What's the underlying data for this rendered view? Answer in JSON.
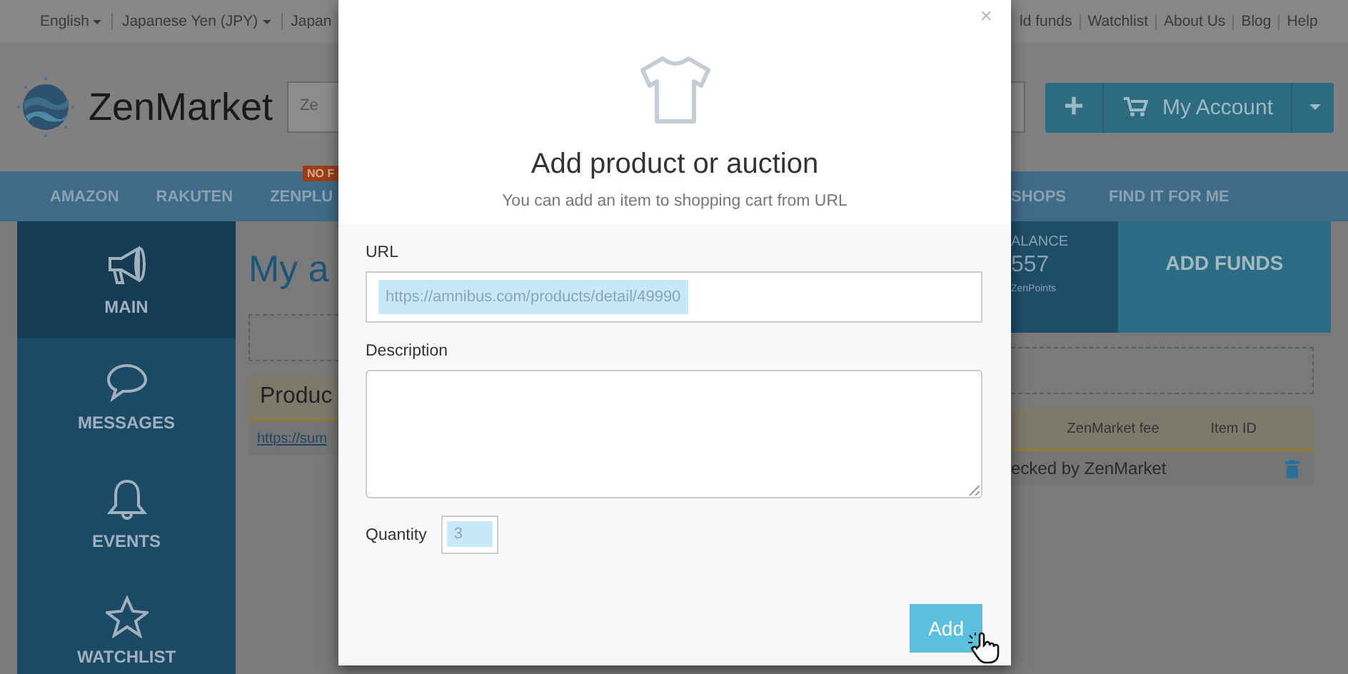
{
  "top_bar": {
    "left_links": [
      {
        "label": "English",
        "dropdown": true
      },
      {
        "label": "Japanese Yen (JPY)",
        "dropdown": true
      },
      {
        "label": "Japan",
        "dropdown": false
      }
    ],
    "right_links": [
      "ld funds",
      "Watchlist",
      "About Us",
      "Blog",
      "Help"
    ]
  },
  "header": {
    "logo": "ZenMarket",
    "search": {
      "value": "Ze"
    },
    "plus_button": "+",
    "account_button": {
      "label": "My Account"
    }
  },
  "nav": {
    "left_items": [
      "AMAZON",
      "RAKUTEN",
      "ZENPLU"
    ],
    "badge": "NO F",
    "right_items": [
      "SHOPS",
      "FIND IT FOR ME"
    ]
  },
  "sidebar": {
    "items": [
      {
        "label": "MAIN",
        "selected": true
      },
      {
        "label": "MESSAGES",
        "selected": false
      },
      {
        "label": "EVENTS",
        "selected": false
      },
      {
        "label": "WATCHLIST",
        "selected": false
      }
    ]
  },
  "main": {
    "title": "My a",
    "table_header": "Produc",
    "link": "https://sum"
  },
  "balance": {
    "label": "ALANCE",
    "amount": "557",
    "points": "ZenPoints"
  },
  "add_funds": "ADD FUNDS",
  "table": {
    "columns": [
      "ZenMarket fee",
      "Item ID"
    ],
    "row_text": "ecked by ZenMarket"
  },
  "modal": {
    "close": "×",
    "title": "Add product or auction",
    "subtitle": "You can add an item to shopping cart from URL",
    "url": {
      "label": "URL",
      "value": "https://amnibus.com/products/detail/49990",
      "highlighted": true
    },
    "description": {
      "label": "Description"
    },
    "quantity": {
      "label": "Quantity",
      "value": "3",
      "highlighted": true
    },
    "add_button": "Add"
  }
}
